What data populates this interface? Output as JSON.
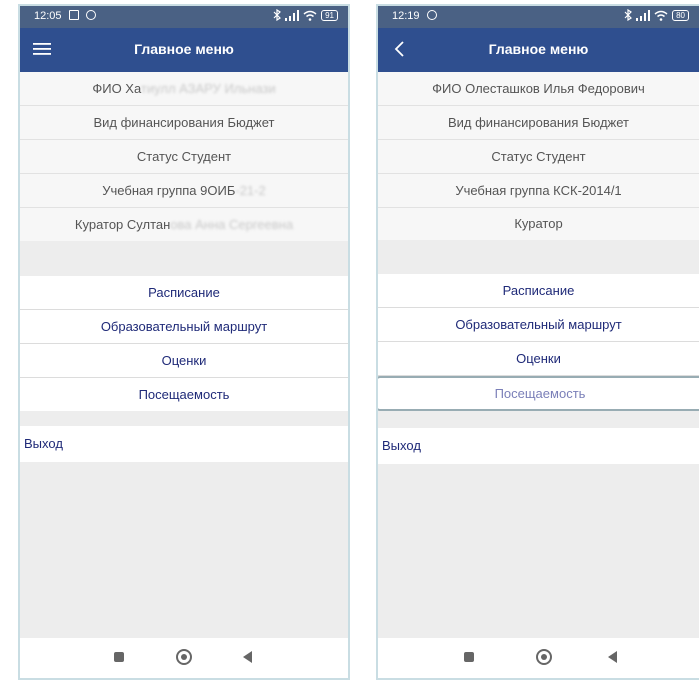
{
  "left": {
    "status_time": "12:05",
    "battery": "91",
    "title": "Главное меню",
    "info": {
      "fio": "ФИО Ха",
      "fio_hidden": "тиулл АЗАРУ Ильнази",
      "financing": "Вид финансирования Бюджет",
      "status": "Статус Студент",
      "group": "Учебная группа 9ОИБ",
      "group_hidden": "-21-2",
      "curator": "Куратор Султан",
      "curator_hidden": "ова Анна Сергеевна"
    },
    "menu": [
      "Расписание",
      "Образовательный маршрут",
      "Оценки",
      "Посещаемость"
    ],
    "exit": "Выход"
  },
  "right": {
    "status_time": "12:19",
    "battery": "80",
    "title": "Главное меню",
    "info": {
      "fio": "ФИО Олесташков Илья Федорович",
      "financing": "Вид финансирования Бюджет",
      "status": "Статус Студент",
      "group": "Учебная группа КСК-2014/1",
      "curator": "Куратор"
    },
    "menu": [
      "Расписание",
      "Образовательный маршрут",
      "Оценки",
      "Посещаемость"
    ],
    "exit": "Выход"
  },
  "icons": {
    "menu": "hamburger-icon",
    "back": "back-arrow-icon",
    "nav_recent": "square-icon",
    "nav_home": "circle-icon",
    "nav_back": "triangle-back-icon"
  },
  "colors": {
    "statusbar": "#4a6184",
    "appbar": "#2f4f8f",
    "menu_text": "#1f2a78",
    "selected_text": "#7a7fb8"
  }
}
